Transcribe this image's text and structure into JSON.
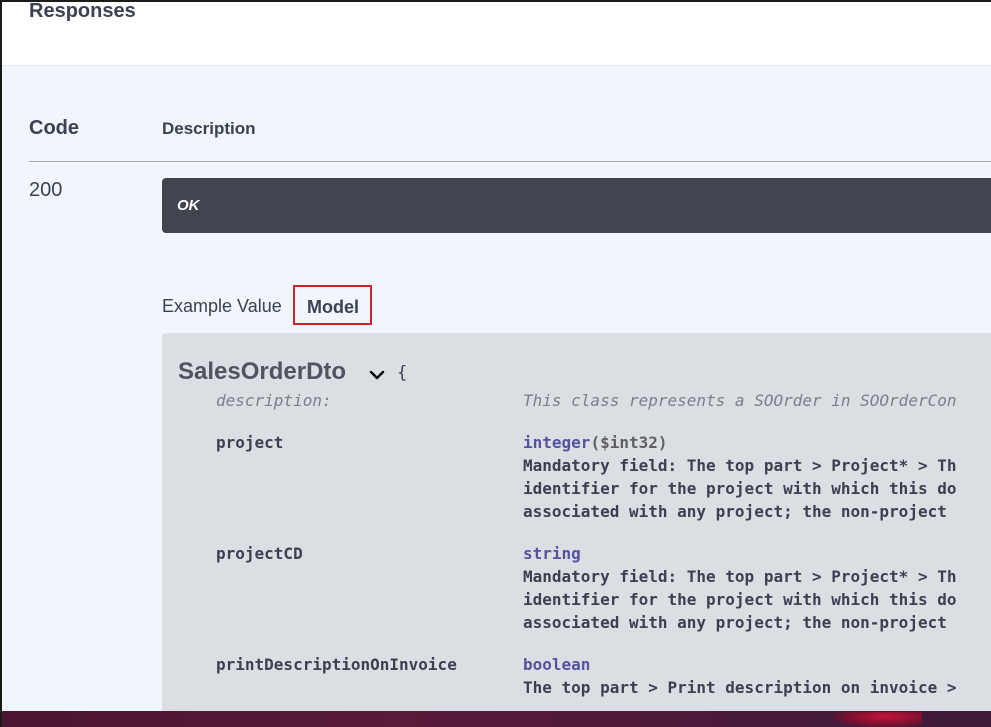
{
  "section": {
    "title": "Responses"
  },
  "table": {
    "code_header": "Code",
    "description_header": "Description",
    "rows": [
      {
        "code": "200",
        "description": "OK"
      }
    ]
  },
  "tabs": {
    "example_value": "Example Value",
    "model": "Model",
    "selected": "Model"
  },
  "model": {
    "name": "SalesOrderDto",
    "open_brace": "{",
    "description_label": "description:",
    "description_value": "This class represents a SOOrder in SOOrderCon",
    "properties": [
      {
        "name": "project",
        "type": "integer",
        "format": "($int32)",
        "lines": [
          "Mandatory field: The top part > Project* > Th",
          "identifier for the project with which this do",
          "associated with any project; the non-project"
        ]
      },
      {
        "name": "projectCD",
        "type": "string",
        "format": "",
        "lines": [
          "Mandatory field: The top part > Project* > Th",
          "identifier for the project with which this do",
          "associated with any project; the non-project"
        ]
      },
      {
        "name": "printDescriptionOnInvoice",
        "type": "boolean",
        "format": "",
        "lines": [
          "The top part > Print description on invoice >"
        ]
      }
    ]
  },
  "colors": {
    "text": "#3b4151",
    "ok_box": "#41444e",
    "model_box": "#dbdee3",
    "type_purple": "#55539e",
    "highlight_red": "#c9262c",
    "panel_bg": "#f0f6fc"
  },
  "icons": {
    "expand": "chevron-down-icon"
  }
}
